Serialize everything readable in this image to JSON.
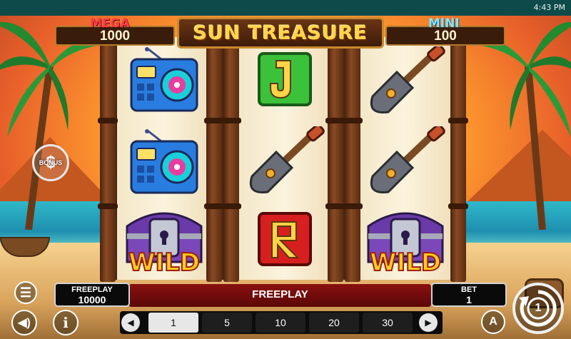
{
  "status_bar": {
    "time": "4:43 PM"
  },
  "game": {
    "title": "SUN TREASURE",
    "jackpots": {
      "mega": {
        "label": "MEGA",
        "value": "1000"
      },
      "mini": {
        "label": "MINI",
        "value": "100"
      }
    },
    "bonus_label": "BONUS",
    "reels": [
      [
        "radio",
        "radio",
        "wild"
      ],
      [
        "J",
        "shovel",
        "A"
      ],
      [
        "shovel",
        "shovel",
        "wild"
      ]
    ],
    "wild_text": "WILD"
  },
  "bottom": {
    "freeplay_box": {
      "label": "FREEPLAY",
      "value": "10000"
    },
    "center_text": "FREEPLAY",
    "bet_box": {
      "label": "BET",
      "value": "1"
    },
    "bet_options": [
      "1",
      "5",
      "10",
      "20",
      "30"
    ],
    "selected_bet": "1",
    "auto_label": "A",
    "spin_count": "1"
  },
  "colors": {
    "title": "#ffd34a",
    "mega": "#ff3b4a",
    "mini": "#7fe6ff",
    "info_bar": "#8a1010"
  }
}
